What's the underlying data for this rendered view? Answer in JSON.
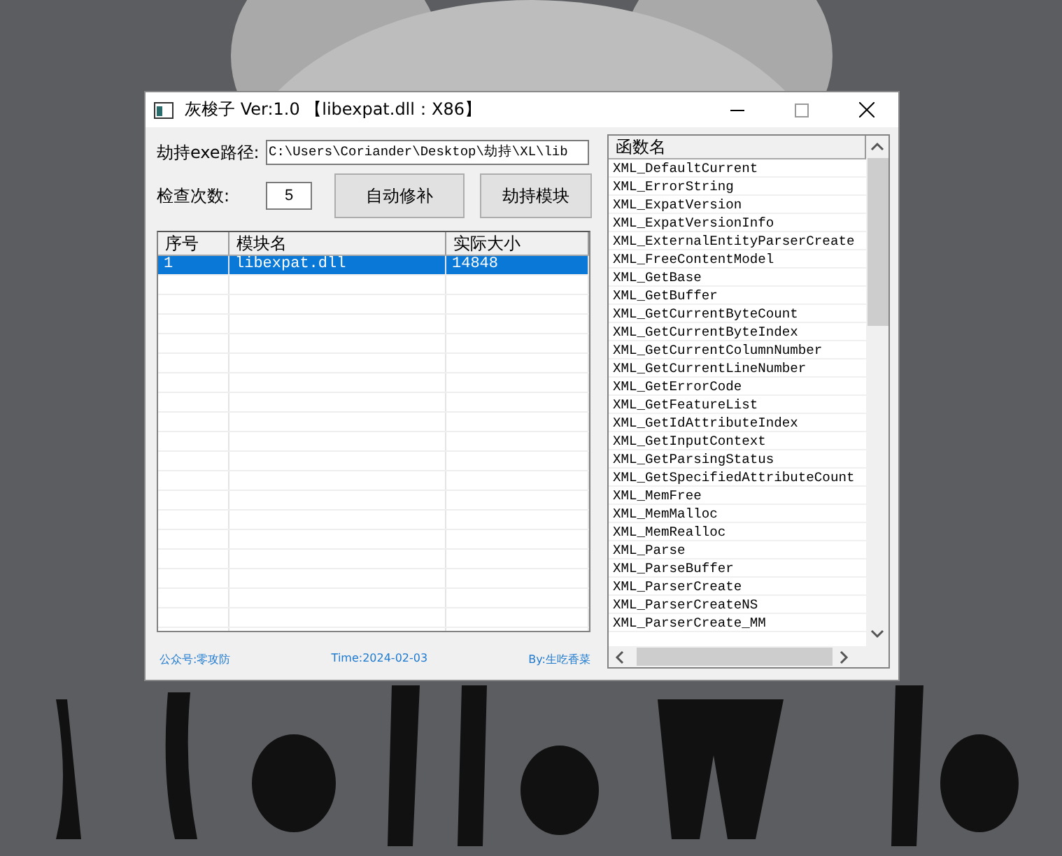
{
  "window": {
    "title": "灰梭子 Ver:1.0  【libexpat.dll：X86】"
  },
  "path_field": {
    "label": "劫持exe路径:",
    "value": "C:\\Users\\Coriander\\Desktop\\劫持\\XL\\lib"
  },
  "count_field": {
    "label": "检查次数:",
    "value": "5"
  },
  "buttons": [
    "自动修补",
    "劫持模块"
  ],
  "modules": {
    "columns": [
      "序号",
      "模块名",
      "实际大小"
    ],
    "rows": [
      {
        "cells": [
          "1",
          "libexpat.dll",
          "14848"
        ],
        "selected": true
      }
    ]
  },
  "functions": {
    "column": "函数名",
    "items": [
      "XML_DefaultCurrent",
      "XML_ErrorString",
      "XML_ExpatVersion",
      "XML_ExpatVersionInfo",
      "XML_ExternalEntityParserCreate",
      "XML_FreeContentModel",
      "XML_GetBase",
      "XML_GetBuffer",
      "XML_GetCurrentByteCount",
      "XML_GetCurrentByteIndex",
      "XML_GetCurrentColumnNumber",
      "XML_GetCurrentLineNumber",
      "XML_GetErrorCode",
      "XML_GetFeatureList",
      "XML_GetIdAttributeIndex",
      "XML_GetInputContext",
      "XML_GetParsingStatus",
      "XML_GetSpecifiedAttributeCount",
      "XML_MemFree",
      "XML_MemMalloc",
      "XML_MemRealloc",
      "XML_Parse",
      "XML_ParseBuffer",
      "XML_ParserCreate",
      "XML_ParserCreateNS",
      "XML_ParserCreate_MM"
    ]
  },
  "status_bar": [
    "公众号:零攻防",
    "Time:2024-02-03",
    "By:生吃香菜"
  ]
}
